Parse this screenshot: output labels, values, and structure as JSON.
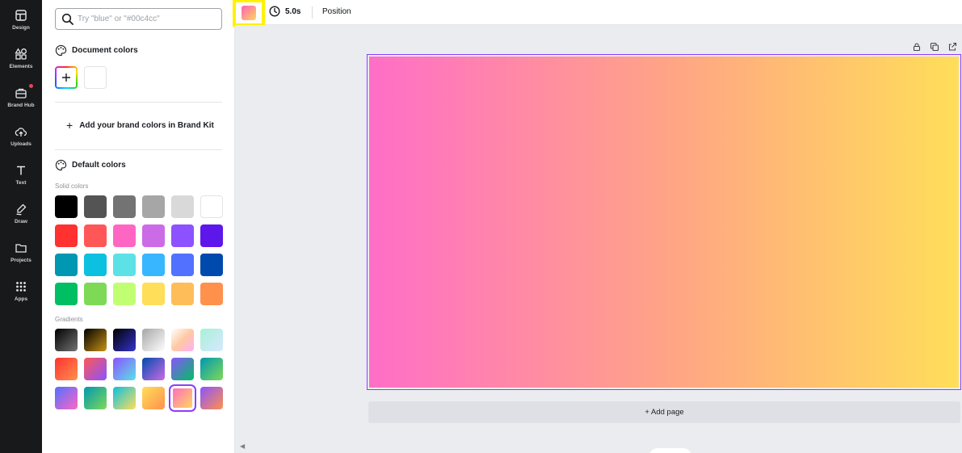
{
  "rail": [
    {
      "label": "Design",
      "icon": "layout-icon"
    },
    {
      "label": "Elements",
      "icon": "shapes-icon"
    },
    {
      "label": "Brand Hub",
      "icon": "briefcase-icon",
      "badge": true
    },
    {
      "label": "Uploads",
      "icon": "cloud-upload-icon"
    },
    {
      "label": "Text",
      "icon": "text-icon"
    },
    {
      "label": "Draw",
      "icon": "pen-icon"
    },
    {
      "label": "Projects",
      "icon": "folder-icon"
    },
    {
      "label": "Apps",
      "icon": "grid-icon"
    }
  ],
  "search": {
    "placeholder": "Try \"blue\" or \"#00c4cc\""
  },
  "document_colors": {
    "title": "Document colors",
    "swatches": [
      "#ffffff"
    ]
  },
  "brand": {
    "add_label": "Add your brand colors in Brand Kit"
  },
  "default_colors": {
    "title": "Default colors",
    "solid_label": "Solid colors",
    "solid": [
      "#000000",
      "#545454",
      "#737373",
      "#a6a6a6",
      "#d9d9d9",
      "#ffffff",
      "#ff3131",
      "#ff5757",
      "#ff66c4",
      "#cb6ce6",
      "#8c52ff",
      "#5e17eb",
      "#0097b2",
      "#0cc0df",
      "#5ce1e6",
      "#38b6ff",
      "#5271ff",
      "#004aad",
      "#00bf63",
      "#7ed957",
      "#c1ff72",
      "#ffde59",
      "#ffbd59",
      "#ff914d"
    ],
    "gradients_label": "Gradients",
    "gradients": [
      [
        "#000000",
        "#737373"
      ],
      [
        "#000000",
        "#c89116"
      ],
      [
        "#000000",
        "#3533cd"
      ],
      [
        "#a6a6a6",
        "#ffffff"
      ],
      [
        "#ffffff",
        "#ffc9a3",
        "#ffaef5"
      ],
      [
        "#a8f0d8",
        "#d7e8ff"
      ],
      [
        "#ff3131",
        "#ff914d"
      ],
      [
        "#ff5757",
        "#8c52ff"
      ],
      [
        "#8c52ff",
        "#5ce1e6"
      ],
      [
        "#004aad",
        "#cb6ce6"
      ],
      [
        "#8c52ff",
        "#00bf63"
      ],
      [
        "#0097b2",
        "#7ed957"
      ],
      [
        "#5170ff",
        "#ff66c4"
      ],
      [
        "#0097b2",
        "#7ed957"
      ],
      [
        "#0cc0df",
        "#ffde59"
      ],
      [
        "#ffde59",
        "#ff914d"
      ],
      [
        "#ff66c4",
        "#ffde59"
      ],
      [
        "#8c52ff",
        "#ff914d"
      ]
    ],
    "selected_gradient": 16
  },
  "toolbar": {
    "duration": "5.0s",
    "position": "Position",
    "current_fill": [
      "#ff5fb9",
      "#ffd85c"
    ]
  },
  "canvas": {
    "fill": [
      "#ff6ec7",
      "#ffa386",
      "#ffde59"
    ],
    "add_page": "+ Add page"
  },
  "colors": {
    "rail_bg": "#18191b",
    "accent": "#8b3dff",
    "highlight": "#fff200",
    "workspace_bg": "#ebecf0"
  }
}
